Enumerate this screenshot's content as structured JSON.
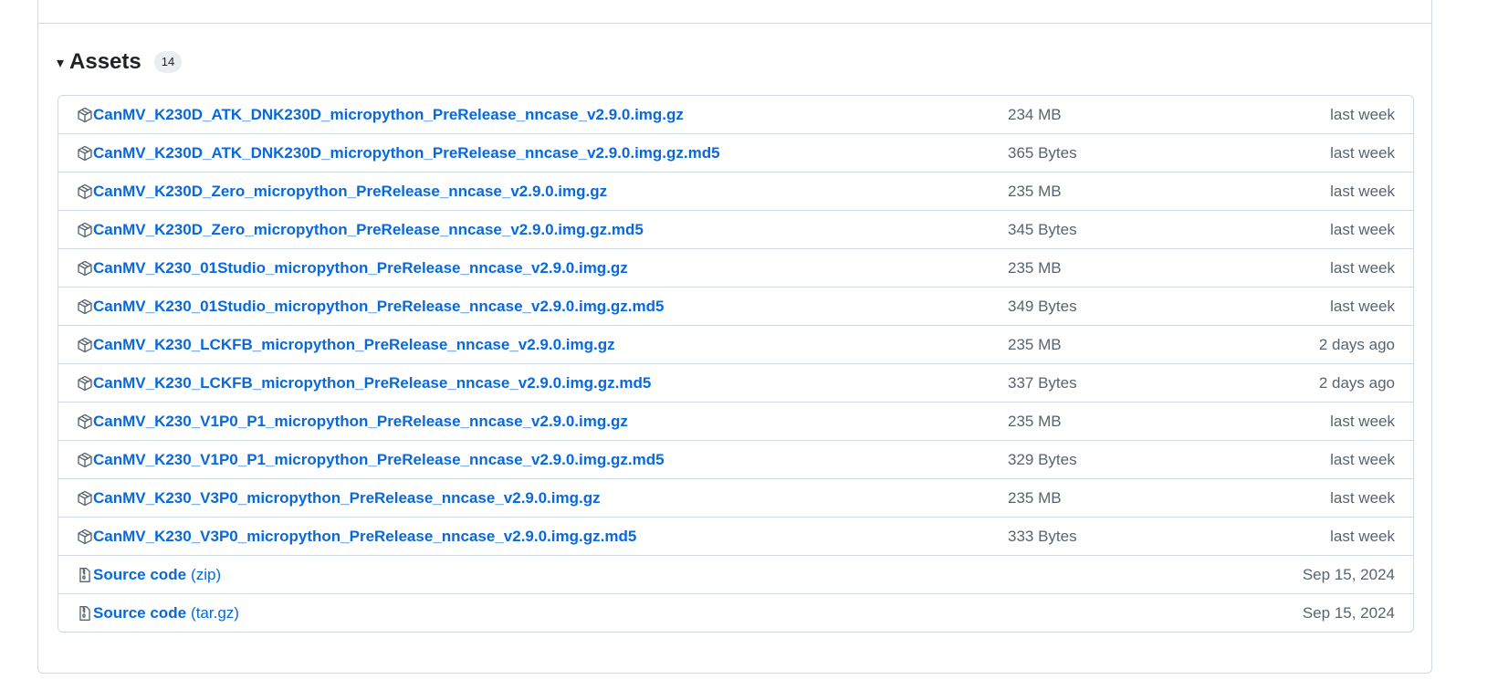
{
  "assets": {
    "title": "Assets",
    "count": "14",
    "items": [
      {
        "name": "CanMV_K230D_ATK_DNK230D_micropython_PreRelease_nncase_v2.9.0.img.gz",
        "size": "234 MB",
        "date": "last week",
        "icon": "package-icon"
      },
      {
        "name": "CanMV_K230D_ATK_DNK230D_micropython_PreRelease_nncase_v2.9.0.img.gz.md5",
        "size": "365 Bytes",
        "date": "last week",
        "icon": "package-icon"
      },
      {
        "name": "CanMV_K230D_Zero_micropython_PreRelease_nncase_v2.9.0.img.gz",
        "size": "235 MB",
        "date": "last week",
        "icon": "package-icon"
      },
      {
        "name": "CanMV_K230D_Zero_micropython_PreRelease_nncase_v2.9.0.img.gz.md5",
        "size": "345 Bytes",
        "date": "last week",
        "icon": "package-icon"
      },
      {
        "name": "CanMV_K230_01Studio_micropython_PreRelease_nncase_v2.9.0.img.gz",
        "size": "235 MB",
        "date": "last week",
        "icon": "package-icon"
      },
      {
        "name": "CanMV_K230_01Studio_micropython_PreRelease_nncase_v2.9.0.img.gz.md5",
        "size": "349 Bytes",
        "date": "last week",
        "icon": "package-icon"
      },
      {
        "name": "CanMV_K230_LCKFB_micropython_PreRelease_nncase_v2.9.0.img.gz",
        "size": "235 MB",
        "date": "2 days ago",
        "icon": "package-icon"
      },
      {
        "name": "CanMV_K230_LCKFB_micropython_PreRelease_nncase_v2.9.0.img.gz.md5",
        "size": "337 Bytes",
        "date": "2 days ago",
        "icon": "package-icon"
      },
      {
        "name": "CanMV_K230_V1P0_P1_micropython_PreRelease_nncase_v2.9.0.img.gz",
        "size": "235 MB",
        "date": "last week",
        "icon": "package-icon"
      },
      {
        "name": "CanMV_K230_V1P0_P1_micropython_PreRelease_nncase_v2.9.0.img.gz.md5",
        "size": "329 Bytes",
        "date": "last week",
        "icon": "package-icon"
      },
      {
        "name": "CanMV_K230_V3P0_micropython_PreRelease_nncase_v2.9.0.img.gz",
        "size": "235 MB",
        "date": "last week",
        "icon": "package-icon"
      },
      {
        "name": "CanMV_K230_V3P0_micropython_PreRelease_nncase_v2.9.0.img.gz.md5",
        "size": "333 Bytes",
        "date": "last week",
        "icon": "package-icon"
      }
    ],
    "source_code": [
      {
        "name": "Source code",
        "suffix": "(zip)",
        "date": "Sep 15, 2024",
        "icon": "file-zip-icon"
      },
      {
        "name": "Source code",
        "suffix": "(tar.gz)",
        "date": "Sep 15, 2024",
        "icon": "file-zip-icon"
      }
    ]
  },
  "colors": {
    "link": "#0969da",
    "muted": "#59636e",
    "border": "#d1d9e0",
    "counter_bg": "#eaeef2"
  }
}
